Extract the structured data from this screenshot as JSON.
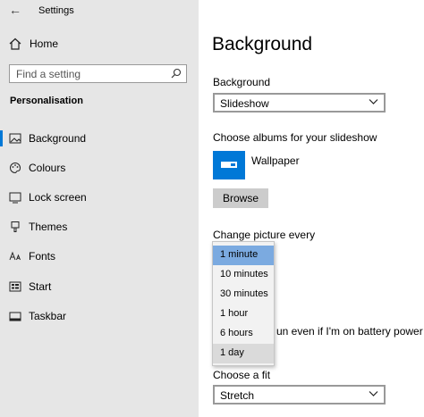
{
  "titlebar": {
    "title": "Settings",
    "back_icon": "back-arrow-icon"
  },
  "home": {
    "label": "Home"
  },
  "search": {
    "placeholder": "Find a setting"
  },
  "sidebar": {
    "section_title": "Personalisation",
    "items": [
      {
        "label": "Background",
        "icon": "picture-icon",
        "active": true
      },
      {
        "label": "Colours",
        "icon": "palette-icon"
      },
      {
        "label": "Lock screen",
        "icon": "lock-screen-icon"
      },
      {
        "label": "Themes",
        "icon": "themes-icon"
      },
      {
        "label": "Fonts",
        "icon": "fonts-icon"
      },
      {
        "label": "Start",
        "icon": "start-icon"
      },
      {
        "label": "Taskbar",
        "icon": "taskbar-icon"
      }
    ]
  },
  "main": {
    "title": "Background",
    "background_label": "Background",
    "background_value": "Slideshow",
    "albums_label": "Choose albums for your slideshow",
    "album_name": "Wallpaper",
    "browse_label": "Browse",
    "change_label": "Change picture every",
    "battery_text_partial": "un even if I'm on battery power",
    "fit_label": "Choose a fit",
    "fit_value": "Stretch"
  },
  "interval_dropdown": {
    "options": [
      "1 minute",
      "10 minutes",
      "30 minutes",
      "1 hour",
      "6 hours",
      "1 day"
    ],
    "selected": "1 minute",
    "hovered": "1 day"
  },
  "colors": {
    "accent": "#0078d7",
    "selected_option": "#7baae0"
  }
}
